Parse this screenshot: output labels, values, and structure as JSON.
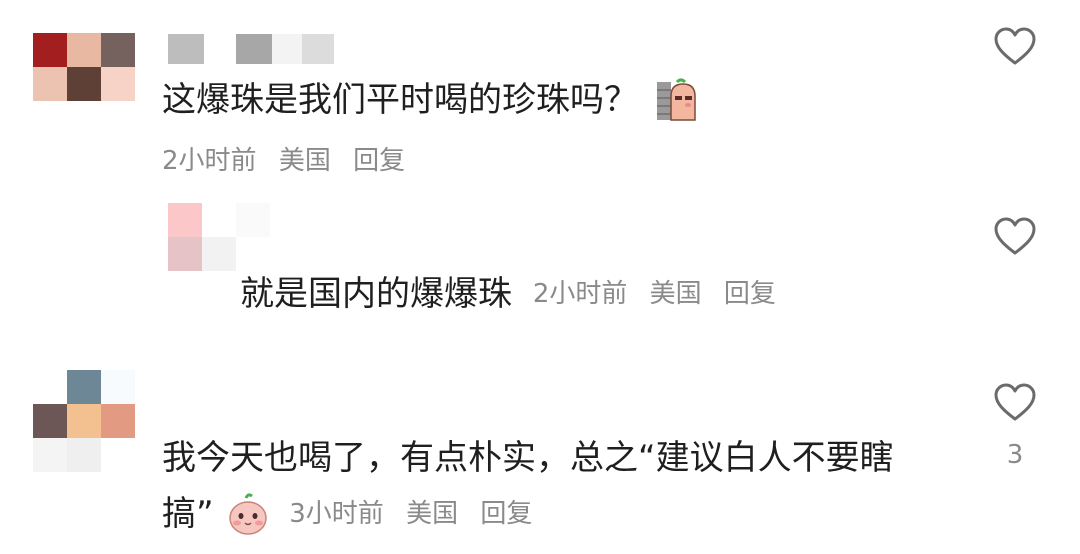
{
  "comments": [
    {
      "avatar_colors": [
        "#a31f1f",
        "#e9b8a3",
        "#75625e",
        "#ecc2b1",
        "#5e4037",
        "#f7d2c6",
        "#ffffff",
        "#ffffff",
        "#ffffff"
      ],
      "username_colors": [
        "#bdbdbd",
        "#ffffff",
        "#a7a7a7",
        "#f3f3f3",
        "#dcdcdc"
      ],
      "text": "这爆珠是我们平时喝的珍珠吗？",
      "emoji": "wall-peek-emoji",
      "time": "2小时前",
      "location": "美国",
      "reply_label": "回复",
      "like_count": ""
    },
    {
      "avatar_colors": [
        "#fbc7c9",
        "#ffffff",
        "#fafafa",
        "#e6c3c7",
        "#f2f2f2",
        "#ffffff"
      ],
      "text": "就是国内的爆爆珠",
      "time": "2小时前",
      "location": "美国",
      "reply_label": "回复",
      "like_count": ""
    },
    {
      "avatar_colors": [
        "#ffffff",
        "#6e8797",
        "#f7fbfd",
        "#6d5656",
        "#f3c08f",
        "#e29a83",
        "#f4f4f4",
        "#efefef",
        "#ffffff"
      ],
      "text_line1": "我今天也喝了，有点朴实，总之“建议白人不要瞎",
      "text_line2": "搞”",
      "emoji": "blushing-face-emoji",
      "time": "3小时前",
      "location": "美国",
      "reply_label": "回复",
      "like_count": "3"
    }
  ]
}
